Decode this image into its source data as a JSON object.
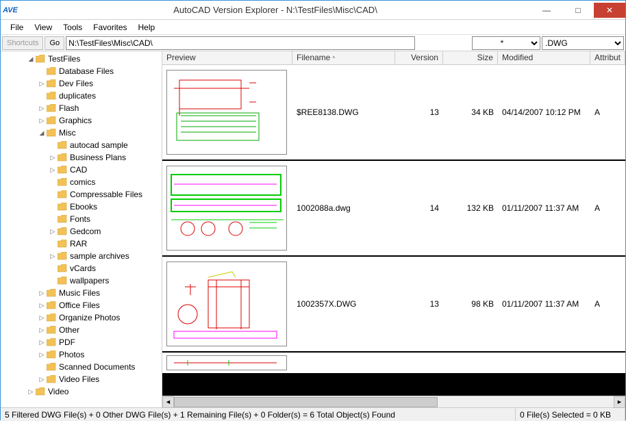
{
  "window": {
    "title": "AutoCAD Version Explorer - N:\\TestFiles\\Misc\\CAD\\",
    "logo_text": "AVE"
  },
  "menu": {
    "file": "File",
    "view": "View",
    "tools": "Tools",
    "favorites": "Favorites",
    "help": "Help"
  },
  "toolbar": {
    "shortcuts": "Shortcuts",
    "go": "Go",
    "path": "N:\\TestFiles\\Misc\\CAD\\",
    "filter_star": "*",
    "filter_ext": ".DWG"
  },
  "tree": {
    "root": {
      "label": "TestFiles",
      "expanded": true,
      "children": [
        {
          "label": "Database Files",
          "exp": ""
        },
        {
          "label": "Dev Files",
          "exp": "▷"
        },
        {
          "label": "duplicates",
          "exp": ""
        },
        {
          "label": "Flash",
          "exp": "▷"
        },
        {
          "label": "Graphics",
          "exp": "▷"
        },
        {
          "label": "Misc",
          "exp": "◢",
          "expanded": true,
          "children": [
            {
              "label": "autocad sample",
              "exp": ""
            },
            {
              "label": "Business Plans",
              "exp": "▷"
            },
            {
              "label": "CAD",
              "exp": "▷"
            },
            {
              "label": "comics",
              "exp": ""
            },
            {
              "label": "Compressable Files",
              "exp": ""
            },
            {
              "label": "Ebooks",
              "exp": ""
            },
            {
              "label": "Fonts",
              "exp": ""
            },
            {
              "label": "Gedcom",
              "exp": "▷"
            },
            {
              "label": "RAR",
              "exp": ""
            },
            {
              "label": "sample archives",
              "exp": "▷"
            },
            {
              "label": "vCards",
              "exp": ""
            },
            {
              "label": "wallpapers",
              "exp": ""
            }
          ]
        },
        {
          "label": "Music Files",
          "exp": "▷"
        },
        {
          "label": "Office Files",
          "exp": "▷"
        },
        {
          "label": "Organize Photos",
          "exp": "▷"
        },
        {
          "label": "Other",
          "exp": "▷"
        },
        {
          "label": "PDF",
          "exp": "▷"
        },
        {
          "label": "Photos",
          "exp": "▷"
        },
        {
          "label": "Scanned Documents",
          "exp": ""
        },
        {
          "label": "Video Files",
          "exp": "▷"
        }
      ]
    },
    "sibling": {
      "label": "Video",
      "exp": "▷"
    }
  },
  "columns": {
    "preview": "Preview",
    "filename": "Filename",
    "version": "Version",
    "size": "Size",
    "modified": "Modified",
    "attributes": "Attribut"
  },
  "rows": [
    {
      "filename": "$REE8138.DWG",
      "version": "13",
      "size": "34 KB",
      "modified": "04/14/2007 10:12 PM",
      "attr": "A"
    },
    {
      "filename": "1002088a.dwg",
      "version": "14",
      "size": "132 KB",
      "modified": "01/11/2007 11:37 AM",
      "attr": "A"
    },
    {
      "filename": "1002357X.DWG",
      "version": "13",
      "size": "98 KB",
      "modified": "01/11/2007 11:37 AM",
      "attr": "A"
    }
  ],
  "status": {
    "left": "5 Filtered DWG File(s) + 0 Other DWG File(s) + 1 Remaining File(s) + 0 Folder(s)  =  6 Total Object(s) Found",
    "right": "0 File(s) Selected = 0 KB"
  }
}
